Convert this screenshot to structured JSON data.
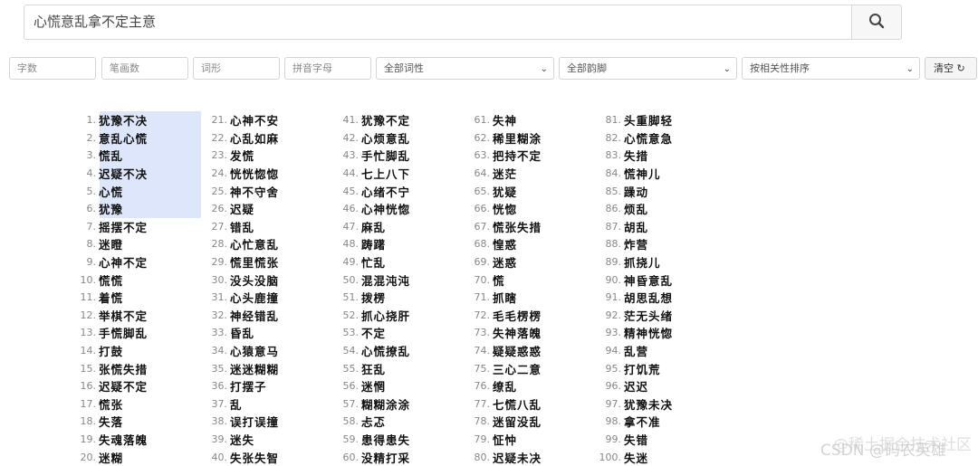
{
  "search": {
    "value": "心慌意乱拿不定主意"
  },
  "filters": {
    "char_count": "字数",
    "stroke_count": "笔画数",
    "word_shape": "词形",
    "pinyin_initial": "拼音字母",
    "pos": "全部词性",
    "rhyme": "全部韵脚",
    "sort": "按相关性排序"
  },
  "clear_label": "清空",
  "results": [
    [
      {
        "n": "1.",
        "w": "犹豫不决"
      },
      {
        "n": "2.",
        "w": "意乱心慌"
      },
      {
        "n": "3.",
        "w": "慌乱"
      },
      {
        "n": "4.",
        "w": "迟疑不决"
      },
      {
        "n": "5.",
        "w": "心慌"
      },
      {
        "n": "6.",
        "w": "犹豫"
      },
      {
        "n": "7.",
        "w": "摇摆不定"
      },
      {
        "n": "8.",
        "w": "迷瞪"
      },
      {
        "n": "9.",
        "w": "心神不定"
      },
      {
        "n": "10.",
        "w": "慌慌"
      },
      {
        "n": "11.",
        "w": "着慌"
      },
      {
        "n": "12.",
        "w": "举棋不定"
      },
      {
        "n": "13.",
        "w": "手慌脚乱"
      },
      {
        "n": "14.",
        "w": "打鼓"
      },
      {
        "n": "15.",
        "w": "张慌失措"
      },
      {
        "n": "16.",
        "w": "迟疑不定"
      },
      {
        "n": "17.",
        "w": "慌张"
      },
      {
        "n": "18.",
        "w": "失落"
      },
      {
        "n": "19.",
        "w": "失魂落魄"
      },
      {
        "n": "20.",
        "w": "迷糊"
      }
    ],
    [
      {
        "n": "21.",
        "w": "心神不安"
      },
      {
        "n": "22.",
        "w": "心乱如麻"
      },
      {
        "n": "23.",
        "w": "发慌"
      },
      {
        "n": "24.",
        "w": "恍恍惚惚"
      },
      {
        "n": "25.",
        "w": "神不守舍"
      },
      {
        "n": "26.",
        "w": "迟疑"
      },
      {
        "n": "27.",
        "w": "错乱"
      },
      {
        "n": "28.",
        "w": "心忙意乱"
      },
      {
        "n": "29.",
        "w": "慌里慌张"
      },
      {
        "n": "30.",
        "w": "没头没脑"
      },
      {
        "n": "31.",
        "w": "心头鹿撞"
      },
      {
        "n": "32.",
        "w": "神经错乱"
      },
      {
        "n": "33.",
        "w": "昏乱"
      },
      {
        "n": "34.",
        "w": "心猿意马"
      },
      {
        "n": "35.",
        "w": "迷迷糊糊"
      },
      {
        "n": "36.",
        "w": "打摆子"
      },
      {
        "n": "37.",
        "w": "乱"
      },
      {
        "n": "38.",
        "w": "误打误撞"
      },
      {
        "n": "39.",
        "w": "迷失"
      },
      {
        "n": "40.",
        "w": "失张失智"
      }
    ],
    [
      {
        "n": "41.",
        "w": "犹豫不定"
      },
      {
        "n": "42.",
        "w": "心烦意乱"
      },
      {
        "n": "43.",
        "w": "手忙脚乱"
      },
      {
        "n": "44.",
        "w": "七上八下"
      },
      {
        "n": "45.",
        "w": "心绪不宁"
      },
      {
        "n": "46.",
        "w": "心神恍惚"
      },
      {
        "n": "47.",
        "w": "麻乱"
      },
      {
        "n": "48.",
        "w": "踌躇"
      },
      {
        "n": "49.",
        "w": "忙乱"
      },
      {
        "n": "50.",
        "w": "混混沌沌"
      },
      {
        "n": "51.",
        "w": "拨楞"
      },
      {
        "n": "52.",
        "w": "抓心挠肝"
      },
      {
        "n": "53.",
        "w": "不定"
      },
      {
        "n": "54.",
        "w": "心慌撩乱"
      },
      {
        "n": "55.",
        "w": "狂乱"
      },
      {
        "n": "56.",
        "w": "迷惘"
      },
      {
        "n": "57.",
        "w": "糊糊涂涂"
      },
      {
        "n": "58.",
        "w": "忐忑"
      },
      {
        "n": "59.",
        "w": "患得患失"
      },
      {
        "n": "60.",
        "w": "没精打采"
      }
    ],
    [
      {
        "n": "61.",
        "w": "失神"
      },
      {
        "n": "62.",
        "w": "稀里糊涂"
      },
      {
        "n": "63.",
        "w": "把持不定"
      },
      {
        "n": "64.",
        "w": "迷茫"
      },
      {
        "n": "65.",
        "w": "犹疑"
      },
      {
        "n": "66.",
        "w": "恍惚"
      },
      {
        "n": "67.",
        "w": "慌张失措"
      },
      {
        "n": "68.",
        "w": "惶惑"
      },
      {
        "n": "69.",
        "w": "迷惑"
      },
      {
        "n": "70.",
        "w": "慌"
      },
      {
        "n": "71.",
        "w": "抓瞎"
      },
      {
        "n": "72.",
        "w": "毛毛楞楞"
      },
      {
        "n": "73.",
        "w": "失神落魄"
      },
      {
        "n": "74.",
        "w": "疑疑惑惑"
      },
      {
        "n": "75.",
        "w": "三心二意"
      },
      {
        "n": "76.",
        "w": "缭乱"
      },
      {
        "n": "77.",
        "w": "七慌八乱"
      },
      {
        "n": "78.",
        "w": "迷留没乱"
      },
      {
        "n": "79.",
        "w": "怔忡"
      },
      {
        "n": "80.",
        "w": "迟疑未决"
      }
    ],
    [
      {
        "n": "81.",
        "w": "头重脚轻"
      },
      {
        "n": "82.",
        "w": "心慌意急"
      },
      {
        "n": "83.",
        "w": "失措"
      },
      {
        "n": "84.",
        "w": "慌神儿"
      },
      {
        "n": "85.",
        "w": "躁动"
      },
      {
        "n": "86.",
        "w": "烦乱"
      },
      {
        "n": "87.",
        "w": "胡乱"
      },
      {
        "n": "88.",
        "w": "炸营"
      },
      {
        "n": "89.",
        "w": "抓挠儿"
      },
      {
        "n": "90.",
        "w": "神昏意乱"
      },
      {
        "n": "91.",
        "w": "胡思乱想"
      },
      {
        "n": "92.",
        "w": "茫无头绪"
      },
      {
        "n": "93.",
        "w": "精神恍惚"
      },
      {
        "n": "94.",
        "w": "乱营"
      },
      {
        "n": "95.",
        "w": "打饥荒"
      },
      {
        "n": "96.",
        "w": "迟迟"
      },
      {
        "n": "97.",
        "w": "犹豫未决"
      },
      {
        "n": "98.",
        "w": "拿不准"
      },
      {
        "n": "99.",
        "w": "失错"
      },
      {
        "n": "100.",
        "w": "失迷"
      }
    ]
  ],
  "watermark": {
    "line1": "@稀土掘金技术社区",
    "line2": "CSDN @码农英雄"
  }
}
